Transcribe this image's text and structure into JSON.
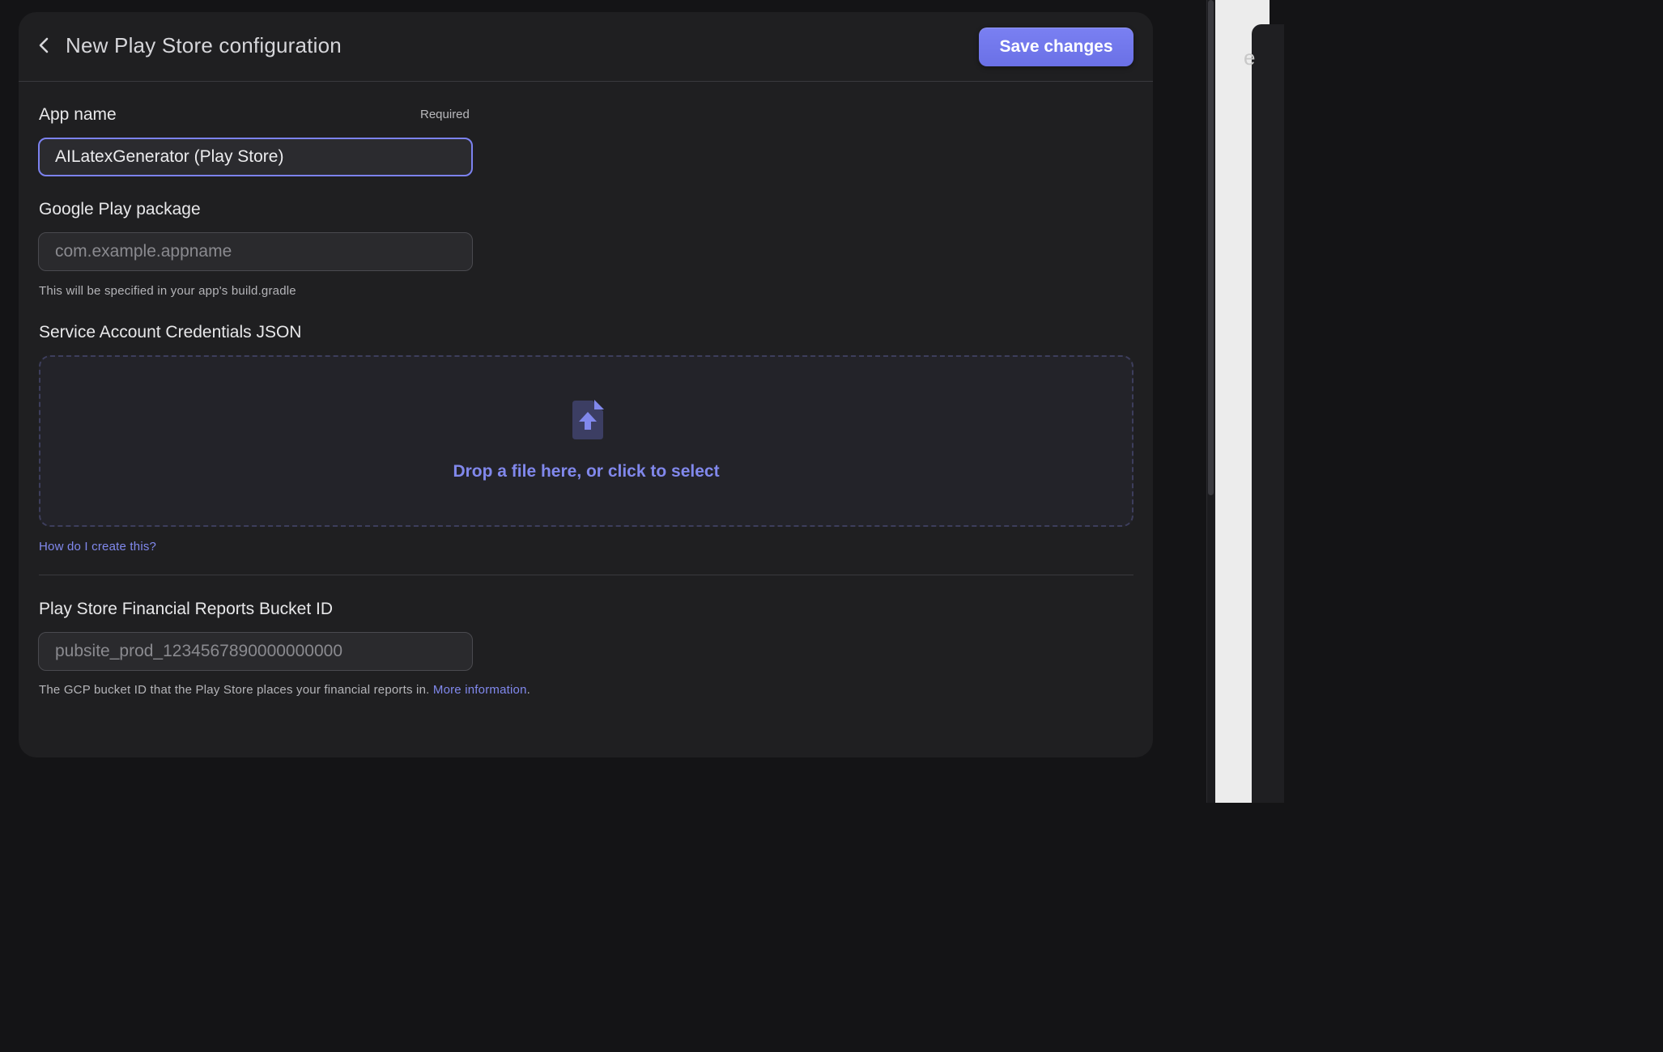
{
  "header": {
    "title": "New Play Store configuration",
    "save_label": "Save changes"
  },
  "app_name": {
    "label": "App name",
    "required_label": "Required",
    "value": "AILatexGenerator (Play Store)"
  },
  "package": {
    "label": "Google Play package",
    "placeholder": "com.example.appname",
    "help": "This will be specified in your app's build.gradle"
  },
  "credentials": {
    "label": "Service Account Credentials JSON",
    "dropzone_text": "Drop a file here, or click to select",
    "help_link": "How do I create this?"
  },
  "bucket": {
    "label": "Play Store Financial Reports Bucket ID",
    "placeholder": "pubsite_prod_1234567890000000000",
    "help": "The GCP bucket ID that the Play Store places your financial reports in.",
    "help_link": "More information",
    "help_suffix": "."
  },
  "icons": {
    "back": "chevron-left-icon",
    "upload": "file-upload-icon"
  },
  "colors": {
    "accent": "#7a80f2",
    "link": "#8189ee",
    "card_bg": "#1f1f21",
    "page_bg": "#141416"
  }
}
